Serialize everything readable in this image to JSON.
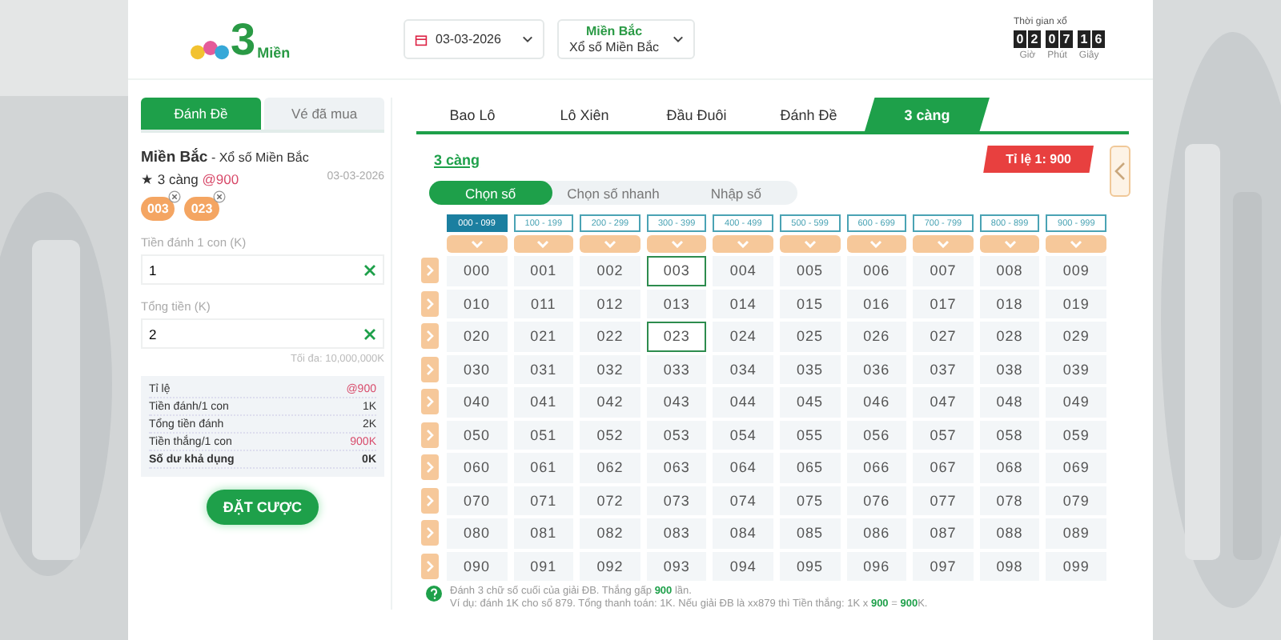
{
  "logo": {
    "numeral": "3",
    "text": "Miền"
  },
  "date_select": {
    "value": "03-03-2026"
  },
  "region_select": {
    "title": "Miền Bắc",
    "subtitle": "Xổ số Miền Bắc"
  },
  "timer": {
    "label": "Thời gian xổ",
    "digits": [
      "0",
      "2",
      "0",
      "7",
      "1",
      "6"
    ],
    "units": [
      "Giờ",
      "Phút",
      "Giây"
    ]
  },
  "side_tabs": [
    {
      "label": "Đánh Đề",
      "selected": true
    },
    {
      "label": "Vé đã mua",
      "selected": false
    }
  ],
  "ticket": {
    "region": "Miền Bắc",
    "separator": " - ",
    "lottery": "Xổ số Miền Bắc",
    "bet_type": "★ 3 càng",
    "odds": "@900",
    "date": "03-03-2026",
    "chips": [
      "003",
      "023"
    ]
  },
  "fields": [
    {
      "label": "Tiền đánh 1 con (K)",
      "value": "1"
    },
    {
      "label": "Tổng tiền (K)",
      "value": "2"
    }
  ],
  "max_note": "Tối đa: 10,000,000K",
  "summary": [
    {
      "label": "Tỉ lệ",
      "value": "@900",
      "kind": "accent"
    },
    {
      "label": "Tiền đánh/1 con",
      "value": "1K",
      "kind": "plain"
    },
    {
      "label": "Tổng tiền đánh",
      "value": "2K",
      "kind": "plain"
    },
    {
      "label": "Tiền thắng/1 con",
      "value": "900K",
      "kind": "accent"
    },
    {
      "label": "Số dư khả dụng",
      "value": "0K",
      "kind": "strong"
    }
  ],
  "bet_button": "ĐẶT CƯỢC",
  "game_tabs": [
    {
      "label": "Bao Lô",
      "selected": false
    },
    {
      "label": "Lô Xiên",
      "selected": false
    },
    {
      "label": "Đầu Đuôi",
      "selected": false
    },
    {
      "label": "Đánh Đề",
      "selected": false
    },
    {
      "label": "3 càng",
      "selected": true
    }
  ],
  "section_title": "3 càng",
  "odds_badge": "Tỉ lệ 1: 900",
  "modes": [
    {
      "label": "Chọn số",
      "selected": true
    },
    {
      "label": "Chọn số nhanh",
      "selected": false
    },
    {
      "label": "Nhập số",
      "selected": false
    }
  ],
  "ranges": [
    {
      "label": "000 - 099",
      "selected": true
    },
    {
      "label": "100 - 199",
      "selected": false
    },
    {
      "label": "200 - 299",
      "selected": false
    },
    {
      "label": "300 - 399",
      "selected": false
    },
    {
      "label": "400 - 499",
      "selected": false
    },
    {
      "label": "500 - 599",
      "selected": false
    },
    {
      "label": "600 - 699",
      "selected": false
    },
    {
      "label": "700 - 799",
      "selected": false
    },
    {
      "label": "800 - 899",
      "selected": false
    },
    {
      "label": "900 - 999",
      "selected": false
    }
  ],
  "grid": [
    [
      {
        "n": "000",
        "selected": false
      },
      {
        "n": "001",
        "selected": false
      },
      {
        "n": "002",
        "selected": false
      },
      {
        "n": "003",
        "selected": true
      },
      {
        "n": "004",
        "selected": false
      },
      {
        "n": "005",
        "selected": false
      },
      {
        "n": "006",
        "selected": false
      },
      {
        "n": "007",
        "selected": false
      },
      {
        "n": "008",
        "selected": false
      },
      {
        "n": "009",
        "selected": false
      }
    ],
    [
      {
        "n": "010",
        "selected": false
      },
      {
        "n": "011",
        "selected": false
      },
      {
        "n": "012",
        "selected": false
      },
      {
        "n": "013",
        "selected": false
      },
      {
        "n": "014",
        "selected": false
      },
      {
        "n": "015",
        "selected": false
      },
      {
        "n": "016",
        "selected": false
      },
      {
        "n": "017",
        "selected": false
      },
      {
        "n": "018",
        "selected": false
      },
      {
        "n": "019",
        "selected": false
      }
    ],
    [
      {
        "n": "020",
        "selected": false
      },
      {
        "n": "021",
        "selected": false
      },
      {
        "n": "022",
        "selected": false
      },
      {
        "n": "023",
        "selected": true
      },
      {
        "n": "024",
        "selected": false
      },
      {
        "n": "025",
        "selected": false
      },
      {
        "n": "026",
        "selected": false
      },
      {
        "n": "027",
        "selected": false
      },
      {
        "n": "028",
        "selected": false
      },
      {
        "n": "029",
        "selected": false
      }
    ],
    [
      {
        "n": "030",
        "selected": false
      },
      {
        "n": "031",
        "selected": false
      },
      {
        "n": "032",
        "selected": false
      },
      {
        "n": "033",
        "selected": false
      },
      {
        "n": "034",
        "selected": false
      },
      {
        "n": "035",
        "selected": false
      },
      {
        "n": "036",
        "selected": false
      },
      {
        "n": "037",
        "selected": false
      },
      {
        "n": "038",
        "selected": false
      },
      {
        "n": "039",
        "selected": false
      }
    ],
    [
      {
        "n": "040",
        "selected": false
      },
      {
        "n": "041",
        "selected": false
      },
      {
        "n": "042",
        "selected": false
      },
      {
        "n": "043",
        "selected": false
      },
      {
        "n": "044",
        "selected": false
      },
      {
        "n": "045",
        "selected": false
      },
      {
        "n": "046",
        "selected": false
      },
      {
        "n": "047",
        "selected": false
      },
      {
        "n": "048",
        "selected": false
      },
      {
        "n": "049",
        "selected": false
      }
    ],
    [
      {
        "n": "050",
        "selected": false
      },
      {
        "n": "051",
        "selected": false
      },
      {
        "n": "052",
        "selected": false
      },
      {
        "n": "053",
        "selected": false
      },
      {
        "n": "054",
        "selected": false
      },
      {
        "n": "055",
        "selected": false
      },
      {
        "n": "056",
        "selected": false
      },
      {
        "n": "057",
        "selected": false
      },
      {
        "n": "058",
        "selected": false
      },
      {
        "n": "059",
        "selected": false
      }
    ],
    [
      {
        "n": "060",
        "selected": false
      },
      {
        "n": "061",
        "selected": false
      },
      {
        "n": "062",
        "selected": false
      },
      {
        "n": "063",
        "selected": false
      },
      {
        "n": "064",
        "selected": false
      },
      {
        "n": "065",
        "selected": false
      },
      {
        "n": "066",
        "selected": false
      },
      {
        "n": "067",
        "selected": false
      },
      {
        "n": "068",
        "selected": false
      },
      {
        "n": "069",
        "selected": false
      }
    ],
    [
      {
        "n": "070",
        "selected": false
      },
      {
        "n": "071",
        "selected": false
      },
      {
        "n": "072",
        "selected": false
      },
      {
        "n": "073",
        "selected": false
      },
      {
        "n": "074",
        "selected": false
      },
      {
        "n": "075",
        "selected": false
      },
      {
        "n": "076",
        "selected": false
      },
      {
        "n": "077",
        "selected": false
      },
      {
        "n": "078",
        "selected": false
      },
      {
        "n": "079",
        "selected": false
      }
    ],
    [
      {
        "n": "080",
        "selected": false
      },
      {
        "n": "081",
        "selected": false
      },
      {
        "n": "082",
        "selected": false
      },
      {
        "n": "083",
        "selected": false
      },
      {
        "n": "084",
        "selected": false
      },
      {
        "n": "085",
        "selected": false
      },
      {
        "n": "086",
        "selected": false
      },
      {
        "n": "087",
        "selected": false
      },
      {
        "n": "088",
        "selected": false
      },
      {
        "n": "089",
        "selected": false
      }
    ],
    [
      {
        "n": "090",
        "selected": false
      },
      {
        "n": "091",
        "selected": false
      },
      {
        "n": "092",
        "selected": false
      },
      {
        "n": "093",
        "selected": false
      },
      {
        "n": "094",
        "selected": false
      },
      {
        "n": "095",
        "selected": false
      },
      {
        "n": "096",
        "selected": false
      },
      {
        "n": "097",
        "selected": false
      },
      {
        "n": "098",
        "selected": false
      },
      {
        "n": "099",
        "selected": false
      }
    ]
  ],
  "notes": [
    "Đánh 3 chữ số cuối của giải ĐB. Thắng gấp **900** lần.",
    "Ví dụ: đánh 1K cho số 879. Tổng thanh toán: 1K. Nếu giải ĐB là xx879 thì Tiền thắng: 1K x **900** = **900**K."
  ]
}
